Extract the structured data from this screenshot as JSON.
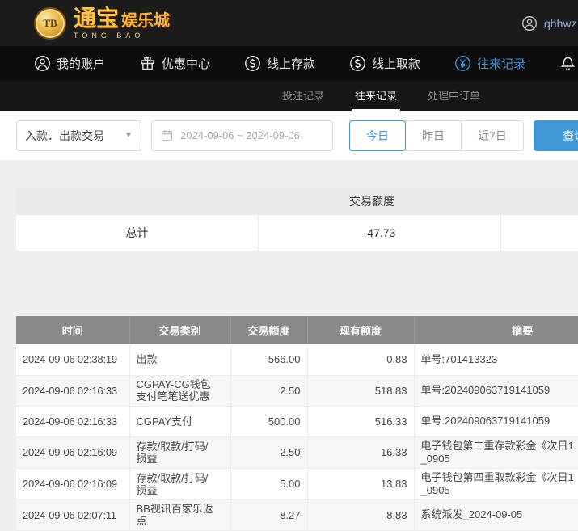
{
  "header": {
    "logo": {
      "coin_text": "TB",
      "title_main": "通宝",
      "title_rest": "娱乐城",
      "subtitle": "TONG BAO"
    },
    "user": {
      "name": "qhhwz"
    }
  },
  "nav": {
    "items": [
      {
        "label": "我的账户",
        "icon": "user-circle-icon"
      },
      {
        "label": "优惠中心",
        "icon": "gift-icon"
      },
      {
        "label": "线上存款",
        "icon": "deposit-coin-icon"
      },
      {
        "label": "线上取款",
        "icon": "withdraw-coin-icon"
      },
      {
        "label": "往来记录",
        "icon": "records-coin-icon"
      },
      {
        "label": "",
        "icon": "bell-icon"
      }
    ],
    "active_color": "#4a90d2"
  },
  "tabs": [
    {
      "label": "投注记录",
      "active": false
    },
    {
      "label": "往来记录",
      "active": true
    },
    {
      "label": "处理中订单",
      "active": false
    }
  ],
  "filters": {
    "type_select": {
      "value": "入款．出款交易"
    },
    "date_range": {
      "value": "2024-09-06 ~ 2024-09-06"
    },
    "quick_ranges": [
      {
        "label": "今日",
        "active": true
      },
      {
        "label": "昨日",
        "active": false
      },
      {
        "label": "近7日",
        "active": false
      }
    ],
    "search_label": "查询"
  },
  "summary": {
    "header": "交易额度",
    "total_label": "总计",
    "total_value": "-47.73"
  },
  "table": {
    "columns": [
      "时间",
      "交易类别",
      "交易额度",
      "现有额度",
      "摘要"
    ],
    "rows": [
      [
        "2024-09-06 02:38:19",
        "出款",
        "-566.00",
        "0.83",
        "单号:701413323"
      ],
      [
        "2024-09-06 02:16:33",
        "CGPAY-CG钱包\n支付笔笔送优惠",
        "2.50",
        "518.83",
        "单号:202409063719141059"
      ],
      [
        "2024-09-06 02:16:33",
        "CGPAY支付",
        "500.00",
        "516.33",
        "单号:202409063719141059"
      ],
      [
        "2024-09-06 02:16:09",
        "存款/取款/打码/\n损益",
        "2.50",
        "16.33",
        "电子钱包第二重存款彩金《次日1\n_0905"
      ],
      [
        "2024-09-06 02:16:09",
        "存款/取款/打码/\n损益",
        "5.00",
        "13.83",
        "电子钱包第四重取款彩金《次日1\n_0905"
      ],
      [
        "2024-09-06 02:07:11",
        "BB视讯百家乐返\n点",
        "8.27",
        "8.83",
        "系统派发_2024-09-05"
      ]
    ]
  },
  "colors": {
    "accent_blue": "#3f97d3",
    "table_header_gray": "#8a8a8a"
  }
}
